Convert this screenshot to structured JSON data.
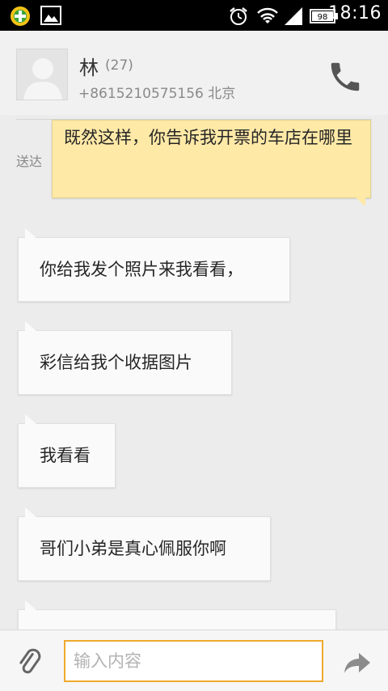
{
  "status_bar": {
    "time": "18:16",
    "battery": "98",
    "icons": [
      "app-notification-icon",
      "image-notification-icon",
      "alarm-icon",
      "wifi-icon",
      "signal-icon",
      "battery-icon"
    ]
  },
  "contact": {
    "name": "林",
    "message_count": "(27)",
    "phone_location": "+8615210575156 北京"
  },
  "messages": [
    {
      "direction": "sent",
      "status": "送达",
      "text": "既然这样，你告诉我开票的车店在哪里"
    },
    {
      "direction": "received",
      "text": "你给我发个照片来我看看，"
    },
    {
      "direction": "received",
      "text": "彩信给我个收据图片"
    },
    {
      "direction": "received",
      "text": "我看看"
    },
    {
      "direction": "received",
      "text": "哥们小弟是真心佩服你啊"
    },
    {
      "direction": "received",
      "text": ""
    }
  ],
  "composer": {
    "placeholder": "输入内容"
  },
  "colors": {
    "status_bar": "#000000",
    "sent_bubble": "#ffe9a7",
    "received_bubble": "#fafafa",
    "input_focus_border": "#f0a92d",
    "background": "#ececec"
  }
}
